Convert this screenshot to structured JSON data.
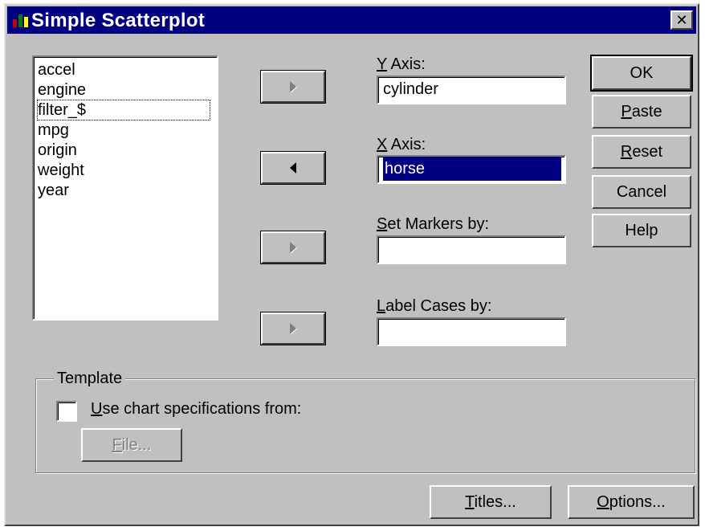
{
  "window": {
    "title": "Simple Scatterplot",
    "close_symbol": "✕",
    "app_icon": "spss-chart-icon",
    "title_bar_color": "#000080"
  },
  "variables": {
    "items": [
      "accel",
      "engine",
      "filter_$",
      "mpg",
      "origin",
      "weight",
      "year"
    ],
    "focused_item": "filter_$"
  },
  "fields": {
    "y_axis": {
      "label_key": "Y",
      "label_rest": " Axis:",
      "value": "cylinder"
    },
    "x_axis": {
      "label_key": "X",
      "label_rest": " Axis:",
      "value": "horse",
      "selected": true
    },
    "set_markers": {
      "label_key": "S",
      "label_rest": "et Markers by:",
      "value": ""
    },
    "label_cases": {
      "label_key": "L",
      "label_rest": "abel Cases by:",
      "value": ""
    }
  },
  "arrow_buttons": {
    "y_axis": "move-right-arrow-icon",
    "x_axis": "move-left-arrow-icon",
    "set_markers": "move-right-arrow-icon",
    "label_cases": "move-right-arrow-icon"
  },
  "buttons": {
    "ok": {
      "label": "OK"
    },
    "paste": {
      "key": "P",
      "rest": "aste"
    },
    "reset": {
      "key": "R",
      "rest": "eset"
    },
    "cancel": {
      "label": "Cancel"
    },
    "help": {
      "label": "Help"
    },
    "titles": {
      "key": "T",
      "rest": "itles..."
    },
    "options": {
      "key": "O",
      "rest": "ptions..."
    }
  },
  "template": {
    "group_title": "Template",
    "checkbox_key": "U",
    "checkbox_rest": "se chart specifications from:",
    "checked": false,
    "file_key": "F",
    "file_rest": "ile...",
    "file_enabled": false
  }
}
